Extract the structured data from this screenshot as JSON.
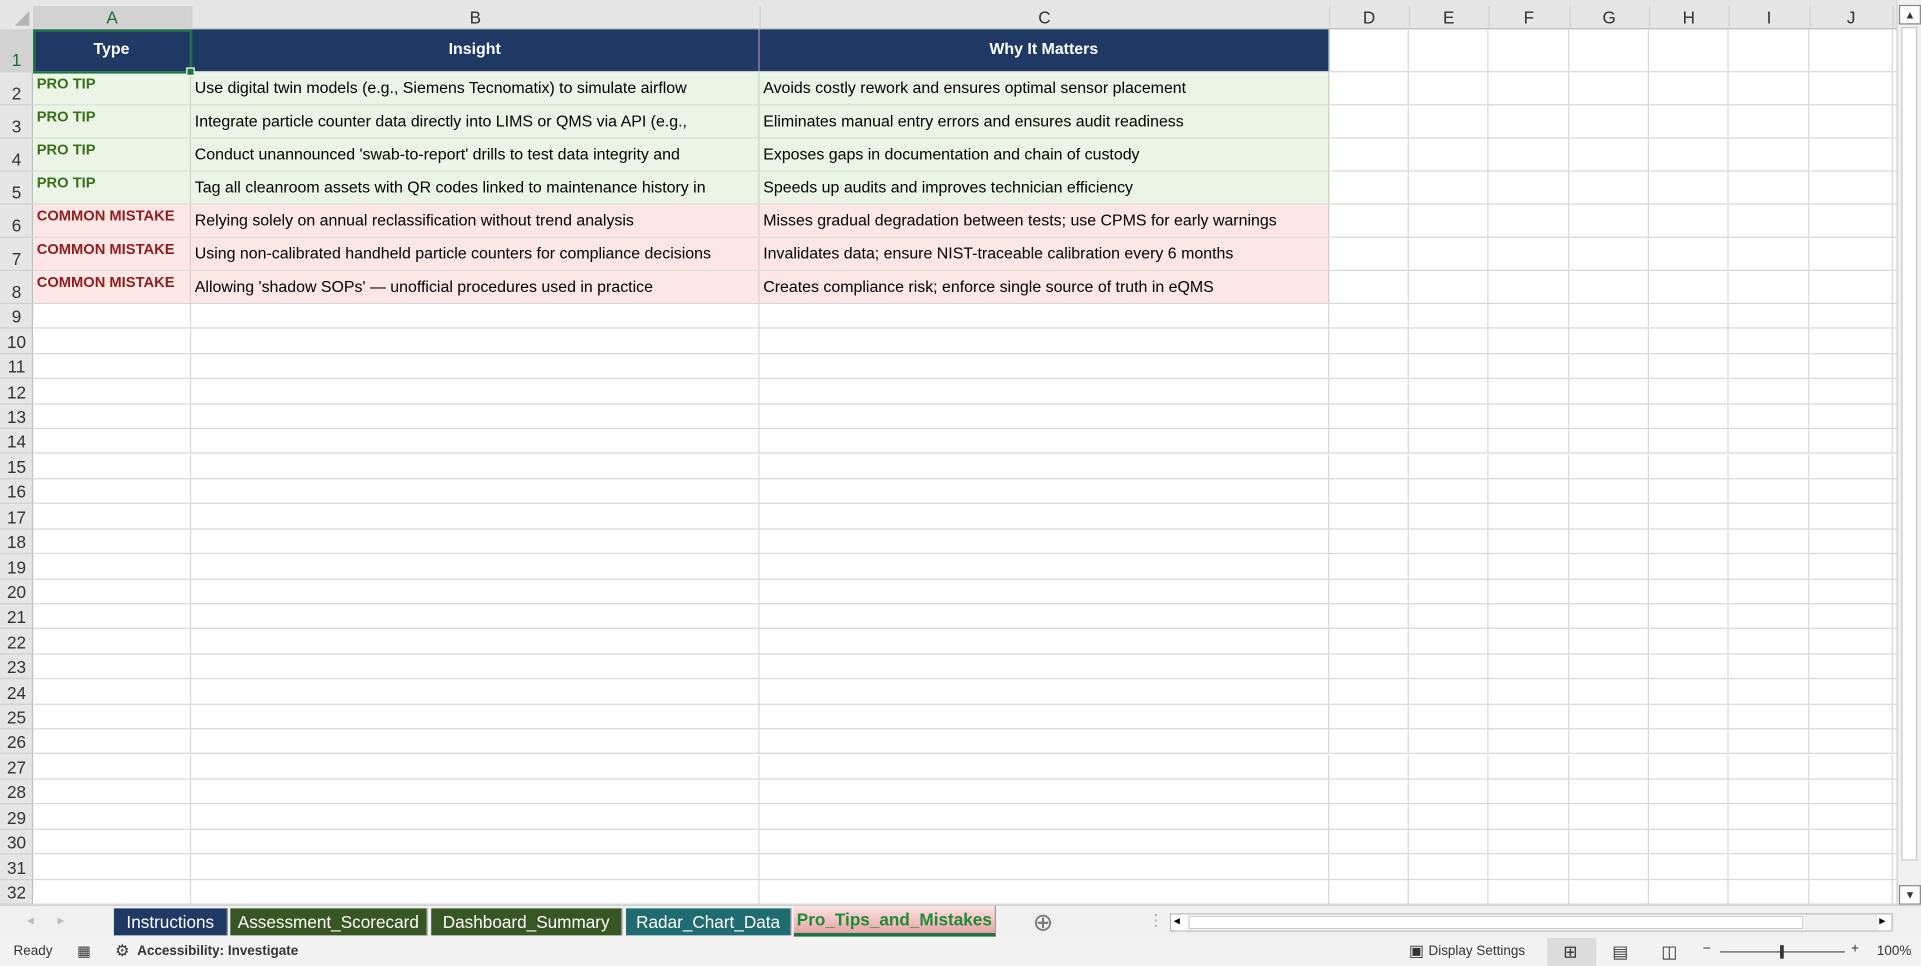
{
  "columns": [
    "A",
    "B",
    "C",
    "D",
    "E",
    "F",
    "G",
    "H",
    "I",
    "J"
  ],
  "row_numbers": [
    "1",
    "2",
    "3",
    "4",
    "5",
    "6",
    "7",
    "8",
    "9",
    "10",
    "11",
    "12",
    "13",
    "14",
    "15",
    "16",
    "17",
    "18",
    "19",
    "20",
    "21",
    "22",
    "23",
    "24",
    "25",
    "26",
    "27",
    "28",
    "29",
    "30",
    "31",
    "32"
  ],
  "table": {
    "headers": [
      "Type",
      "Insight",
      "Why It Matters"
    ],
    "rows": [
      {
        "kind": "tip",
        "type": "PRO TIP",
        "insight": "Use digital twin models (e.g., Siemens Tecnomatix) to simulate airflow",
        "why": "Avoids costly rework and ensures optimal sensor placement"
      },
      {
        "kind": "tip",
        "type": "PRO TIP",
        "insight": "Integrate particle counter data directly into LIMS or QMS via API (e.g.,",
        "why": "Eliminates manual entry errors and ensures audit readiness"
      },
      {
        "kind": "tip",
        "type": "PRO TIP",
        "insight": "Conduct unannounced 'swab-to-report' drills to test data integrity and",
        "why": "Exposes gaps in documentation and chain of custody"
      },
      {
        "kind": "tip",
        "type": "PRO TIP",
        "insight": "Tag all cleanroom assets with QR codes linked to maintenance history in",
        "why": "Speeds up audits and improves technician efficiency"
      },
      {
        "kind": "mis",
        "type": "COMMON MISTAKE",
        "insight": "Relying solely on annual reclassification without trend analysis",
        "why": "Misses gradual degradation between tests; use CPMS for early warnings"
      },
      {
        "kind": "mis",
        "type": "COMMON MISTAKE",
        "insight": "Using non-calibrated handheld particle counters for compliance decisions",
        "why": "Invalidates data; ensure NIST-traceable calibration every 6 months"
      },
      {
        "kind": "mis",
        "type": "COMMON MISTAKE",
        "insight": "Allowing 'shadow SOPs' — unofficial procedures used in practice",
        "why": "Creates compliance risk; enforce single source of truth in eQMS"
      }
    ]
  },
  "sheet_tabs": [
    {
      "label": "Instructions",
      "color": "#203864"
    },
    {
      "label": "Assessment_Scorecard",
      "color": "#375623"
    },
    {
      "label": "Dashboard_Summary",
      "color": "#375623"
    },
    {
      "label": "Radar_Chart_Data",
      "color": "#1f6b70"
    },
    {
      "label": "Pro_Tips_and_Mistakes",
      "color": "#f4c7c7",
      "active": true
    }
  ],
  "status": {
    "ready": "Ready",
    "accessibility": "Accessibility: Investigate",
    "display_settings": "Display Settings",
    "zoom": "100%",
    "zoom_minus": "−",
    "zoom_plus": "+"
  },
  "icons": {
    "add_sheet": "⊕",
    "left": "◂",
    "right": "▸",
    "up": "▲",
    "down": "▼"
  }
}
